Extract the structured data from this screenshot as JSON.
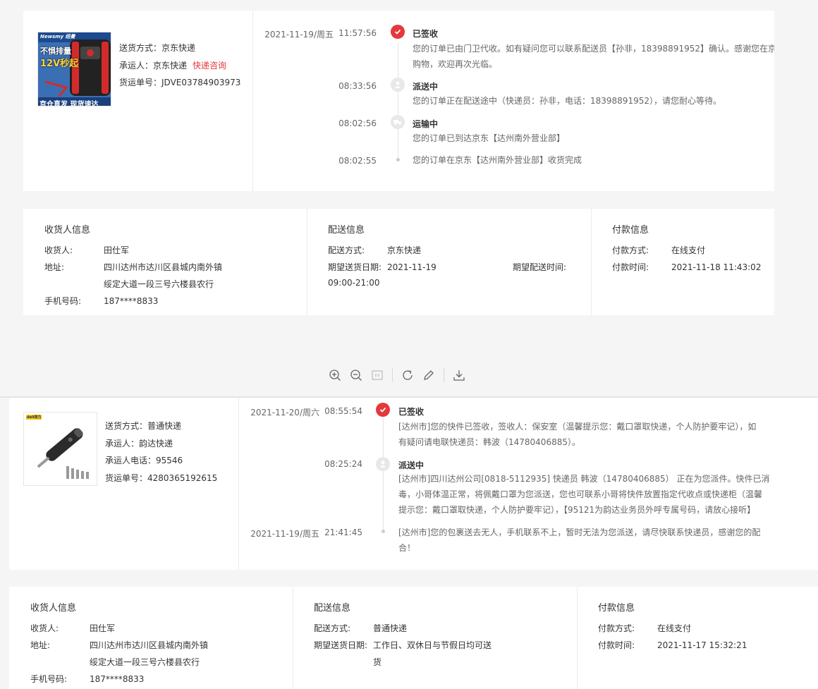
{
  "order1": {
    "shipping": {
      "method_label": "送货方式：",
      "method": "京东快递",
      "carrier_label": "承运人：",
      "carrier": "京东快递",
      "consult_link": "快递咨询",
      "tracking_label": "货运单号：",
      "tracking": "JDVE03784903973"
    },
    "product_image": {
      "brand": "Newsmy 纽曼",
      "line1": "不惧排量",
      "line2": "12V秒起",
      "footer": "京仓直发 现货速达"
    },
    "timeline": [
      {
        "date": "2021-11-19/周五",
        "time": "11:57:56",
        "status": "已签收",
        "text_lines": [
          "您的订单已由门卫代收。如有疑问您可以联系配送员【孙非，18398891952】确认。感谢您在京东",
          "购物，欢迎再次光临。"
        ],
        "icon": "check-icon"
      },
      {
        "date": "",
        "time": "08:33:56",
        "status": "派送中",
        "text_lines": [
          "您的订单正在配送途中（快递员：孙非，电话：18398891952），请您耐心等待。"
        ],
        "icon": "courier-icon"
      },
      {
        "date": "",
        "time": "08:02:56",
        "status": "运输中",
        "text_lines": [
          "您的订单已到达京东【达州南外营业部】"
        ],
        "icon": "truck-icon"
      },
      {
        "date": "",
        "time": "08:02:55",
        "status": "",
        "text_lines": [
          "您的订单在京东【达州南外营业部】收货完成"
        ],
        "icon": "dot-icon"
      }
    ],
    "receiver": {
      "title": "收货人信息",
      "name_label": "收货人:",
      "name": "田仕军",
      "addr_label": "地址:",
      "addr1": "四川达州市达川区县城内南外镇",
      "addr2": "绥定大道一段三号六楼县农行",
      "phone_label": "手机号码:",
      "phone": "187****8833"
    },
    "delivery": {
      "title": "配送信息",
      "method_label": "配送方式:",
      "method": "京东快递",
      "date_label": "期望送货日期:",
      "date": "2021-11-19",
      "time_label": "期望配送时间:",
      "time": "09:00-21:00"
    },
    "payment": {
      "title": "付款信息",
      "method_label": "付款方式:",
      "method": "在线支付",
      "time_label": "付款时间:",
      "time": "2021-11-18 11:43:02"
    }
  },
  "order2": {
    "shipping": {
      "method_label": "送货方式：",
      "method": "普通快递",
      "carrier_label": "承运人：",
      "carrier": "韵达快递",
      "phone_label": "承运人电话：",
      "phone": "95546",
      "tracking_label": "货运单号：",
      "tracking": "4280365192615"
    },
    "product_image": {
      "brand": "deli得力"
    },
    "timeline": [
      {
        "date": "2021-11-20/周六",
        "time": "08:55:54",
        "status": "已签收",
        "text_lines": [
          "[达州市]您的快件已签收，签收人：保安室（温馨提示您：戴口罩取快递，个人防护要牢记），如",
          "有疑问请电联快递员：韩波（14780406885）。"
        ],
        "icon": "check-icon"
      },
      {
        "date": "",
        "time": "08:25:24",
        "status": "派送中",
        "text_lines": [
          "[达州市]四川达州公司[0818-5112935] 快递员 韩波（14780406885） 正在为您派件。快件已消",
          "毒，小哥体温正常，将佩戴口罩为您派送，您也可联系小哥将快件放置指定代收点或快递柜（温馨",
          "提示您：戴口罩取快递，个人防护要牢记），【95121为韵达业务员外呼专属号码，请放心接听】"
        ],
        "icon": "courier-icon"
      },
      {
        "date": "2021-11-19/周五",
        "time": "21:41:45",
        "status": "",
        "text_lines": [
          "[达州市]您的包裹送去无人，手机联系不上，暂时无法为您派送，请尽快联系快递员，感谢您的配",
          "合！"
        ],
        "icon": "dot-icon"
      }
    ],
    "receiver": {
      "title": "收货人信息",
      "name_label": "收货人:",
      "name": "田仕军",
      "addr_label": "地址:",
      "addr1": "四川达州市达川区县城内南外镇",
      "addr2": "绥定大道一段三号六楼县农行",
      "phone_label": "手机号码:",
      "phone": "187****8833"
    },
    "delivery": {
      "title": "配送信息",
      "method_label": "配送方式:",
      "method": "普通快递",
      "date_label": "期望送货日期:",
      "date_line1": "工作日、双休日与节假日均可送",
      "date_line2": "货"
    },
    "payment": {
      "title": "付款信息",
      "method_label": "付款方式:",
      "method": "在线支付",
      "time_label": "付款时间:",
      "time": "2021-11-17 15:32:21"
    }
  },
  "toolbar": {
    "buttons": [
      "zoom-in-icon",
      "zoom-out-icon",
      "fit-icon",
      "rotate-icon",
      "edit-icon",
      "download-icon"
    ]
  },
  "colors": {
    "accent": "#e4393c",
    "border": "#ececec",
    "background": "#f5f5f5"
  }
}
